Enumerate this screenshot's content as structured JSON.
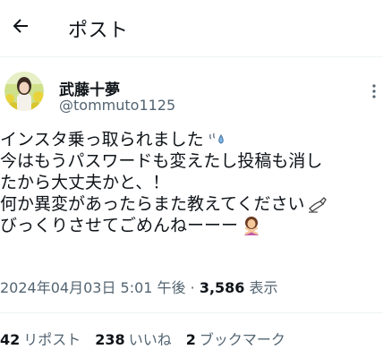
{
  "header": {
    "title": "ポスト",
    "back_icon": "arrow-left-icon"
  },
  "author": {
    "display_name": "武藤十夢",
    "handle": "@tommuto1125",
    "avatar_icon": "profile-photo",
    "more_icon": "more-vertical-icon"
  },
  "tweet": {
    "lines": [
      "インスタ乗っ取られました",
      "今はもうパスワードも変えたし投稿も消し",
      "たから大丈夫かと、！",
      "何か異変があったらまた教えてください",
      "びっくりさせてごめんねーーー"
    ],
    "emojis": {
      "line1": "sweat-drops-icon",
      "line4": "writing-hand-icon",
      "line5": "person-gesturing-no-icon"
    }
  },
  "meta": {
    "datetime": "2024年04月03日 5:01 午後",
    "separator": "·",
    "views_count": "3,586",
    "views_label": "表示"
  },
  "stats": {
    "reposts_count": "42",
    "reposts_label": "リポスト",
    "likes_count": "238",
    "likes_label": "いいね",
    "bookmarks_count": "2",
    "bookmarks_label": "ブックマーク"
  },
  "colors": {
    "text": "#0f1419",
    "secondary": "#536471",
    "divider": "#eff3f4"
  }
}
